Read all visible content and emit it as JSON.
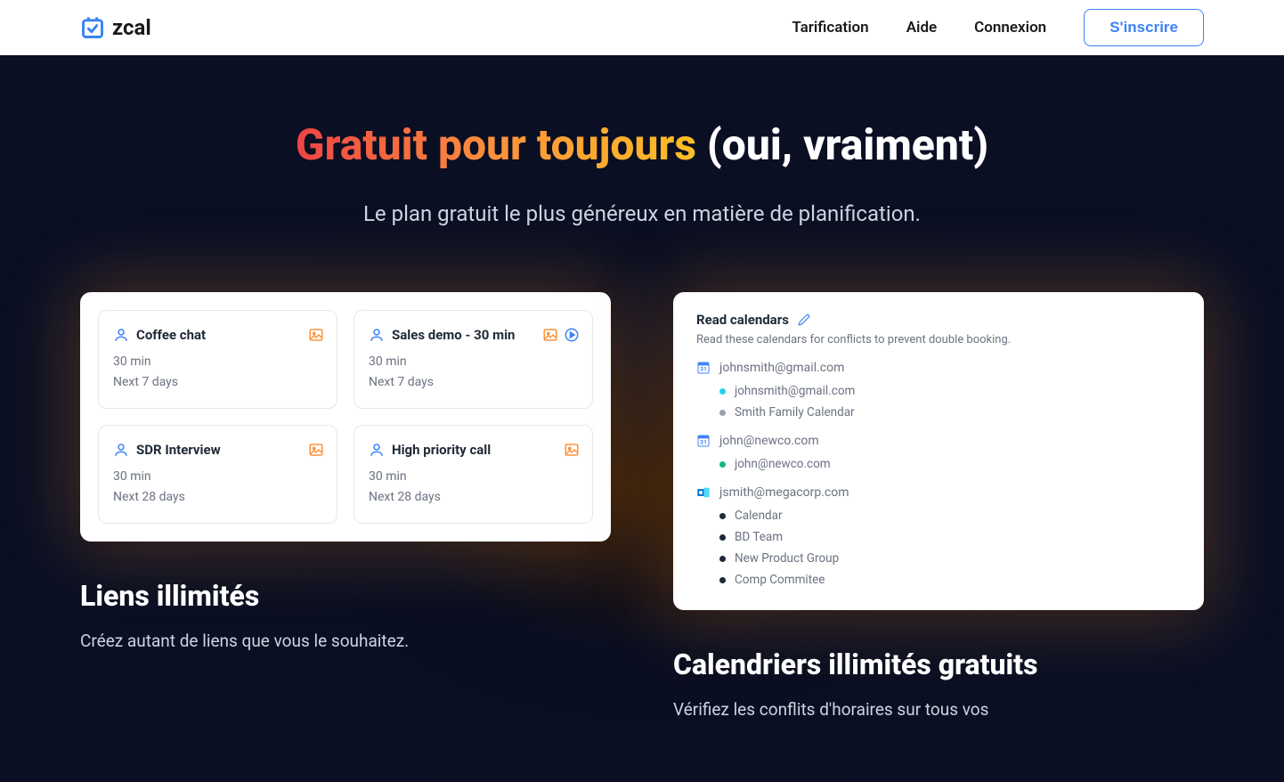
{
  "header": {
    "logo_text": "zcal",
    "nav": {
      "pricing": "Tarification",
      "help": "Aide",
      "login": "Connexion",
      "signup": "S'inscrire"
    }
  },
  "hero": {
    "title_gradient": "Gratuit pour toujours",
    "title_rest": " (oui, vraiment)",
    "subtitle": "Le plan gratuit le plus généreux en matière de planification."
  },
  "meetings": [
    {
      "title": "Coffee chat",
      "duration": "30 min",
      "range": "Next 7 days",
      "has_record": false
    },
    {
      "title": "Sales demo - 30 min",
      "duration": "30 min",
      "range": "Next 7 days",
      "has_record": true
    },
    {
      "title": "SDR Interview",
      "duration": "30 min",
      "range": "Next 28 days",
      "has_record": false
    },
    {
      "title": "High priority call",
      "duration": "30 min",
      "range": "Next 28 days",
      "has_record": false
    }
  ],
  "calendars": {
    "title": "Read calendars",
    "desc": "Read these calendars for conflicts to prevent double booking.",
    "accounts": [
      {
        "provider": "google",
        "email": "johnsmith@gmail.com",
        "subs": [
          {
            "name": "johnsmith@gmail.com",
            "color": "cyan"
          },
          {
            "name": "Smith Family Calendar",
            "color": "gray"
          }
        ]
      },
      {
        "provider": "google",
        "email": "john@newco.com",
        "subs": [
          {
            "name": "john@newco.com",
            "color": "green"
          }
        ]
      },
      {
        "provider": "outlook",
        "email": "jsmith@megacorp.com",
        "subs": [
          {
            "name": "Calendar",
            "color": "black"
          },
          {
            "name": "BD Team",
            "color": "black"
          },
          {
            "name": "New Product Group",
            "color": "black"
          },
          {
            "name": "Comp Commitee",
            "color": "black"
          }
        ]
      }
    ]
  },
  "features": {
    "left": {
      "title": "Liens illimités",
      "desc": "Créez autant de liens que vous le souhaitez."
    },
    "right": {
      "title": "Calendriers illimités gratuits",
      "desc": "Vérifiez les conflits d'horaires sur tous vos"
    }
  }
}
